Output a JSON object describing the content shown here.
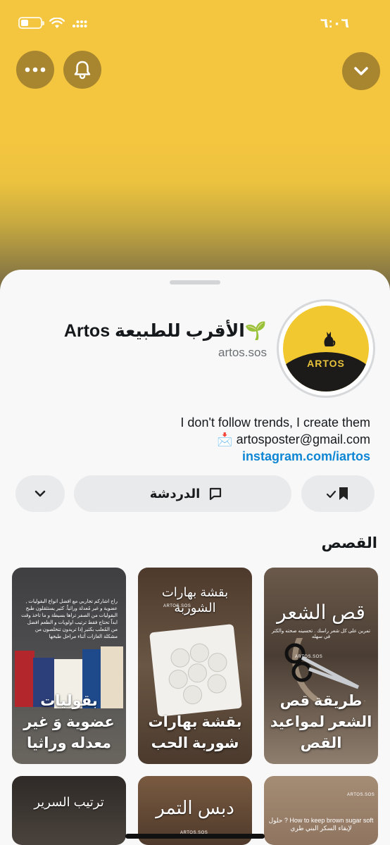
{
  "theme": {
    "hero_color": "#f4c53f",
    "link_color": "#0e86d4",
    "pill_color": "#e9eaec"
  },
  "status_bar": {
    "time": "٦:٠٦",
    "icons": [
      "battery-icon",
      "wifi-icon",
      "signal-icon"
    ]
  },
  "top_actions": {
    "more_icon": "more-dots-icon",
    "notify_icon": "bell-icon",
    "collapse_icon": "chevron-down-icon"
  },
  "profile": {
    "display_name": "🌱الأقرب للطبيعة Artos",
    "username": "artos.sos",
    "avatar_text": "ARTOS",
    "bio_lines": [
      "I don't follow trends, I create them",
      "📩 artosposter@gmail.com"
    ],
    "link": "instagram.com/iartos"
  },
  "actions": {
    "chat_label": "الدردشة",
    "chat_icon": "chat-bubble-icon",
    "subscribe_icon": "bookmark-check-icon",
    "more_icon": "chevron-down-icon"
  },
  "stories": {
    "title": "القصص",
    "items": [
      {
        "title": "طريقة قص الشعر لمواعيد القص",
        "header": "قص الشعر",
        "caption": "تمرين على كل شعر راسك . تحسينه صحته والكثر في سهله",
        "watermark": "ARTOS.SOS",
        "color": "#5a4a3e"
      },
      {
        "title": "بقشة بهارات شوربة الحب",
        "header": "بقشة بهارات الشوربة",
        "caption": "",
        "watermark": "ARTOS.SOS",
        "color": "#6b5a48"
      },
      {
        "title": "بقوليات عضوية وَ غير معدله وراثيا",
        "header": "",
        "caption": "راح اشاركم تجاربي مع افضل انواع البقوليات , عضوية و غير مُعدلة وراثياً. كثير يستثقلون طبخ البقوليات من الصفر تراها بسيطة و ما تاخذ وقت ابداً تحتاج فقط ترتيب اولويات و الطعم افضل من المُعلب بكثير إذا تريدون تتخلصون من مشكلة الغازات أثناء مراحل طبخها",
        "watermark": "",
        "color": "#4b4a4c"
      },
      {
        "title": "",
        "header": "",
        "caption": "",
        "subcaption": "How to keep brown sugar soft ? حلول لإبقاء السكر البني طري",
        "watermark": "ARTOS.SOS",
        "color": "#8f7560"
      },
      {
        "title": "",
        "header": "دبس التمر",
        "caption": "",
        "watermark": "ARTOS.SOS",
        "color": "#5f4a3a"
      },
      {
        "title": "",
        "header": "ترتيب السرير",
        "caption": "",
        "watermark": "",
        "color": "#3d3631"
      }
    ]
  }
}
